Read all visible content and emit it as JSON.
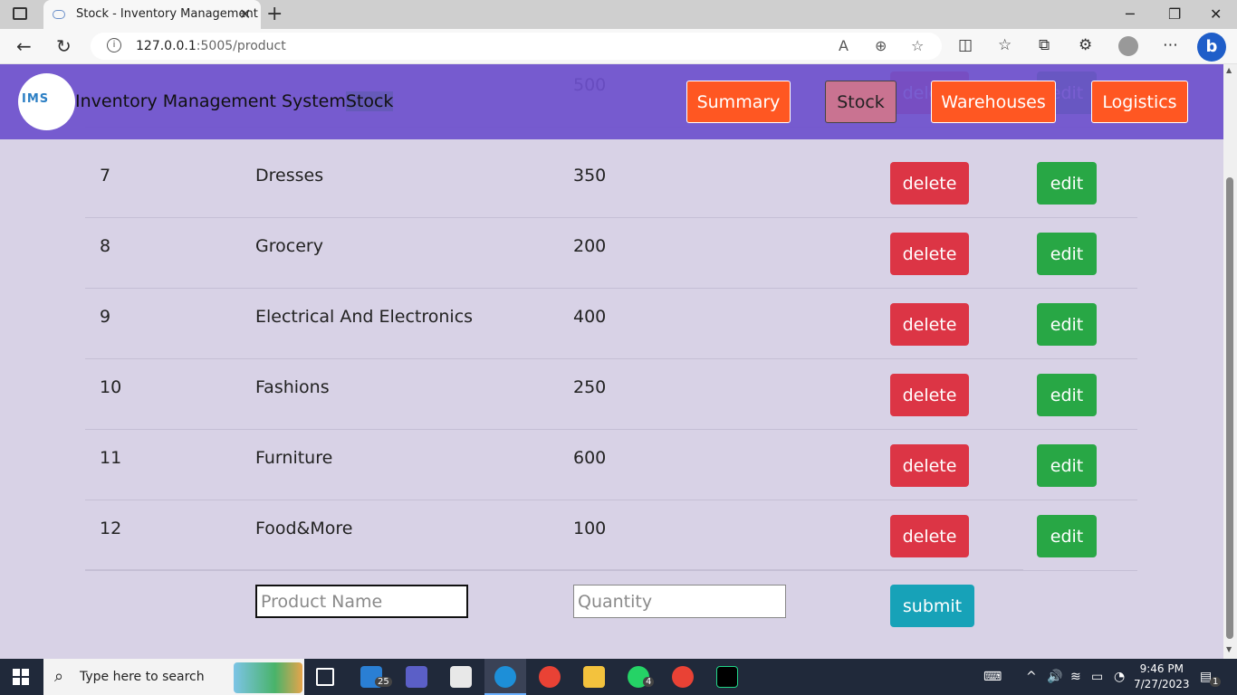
{
  "browser": {
    "tab_title": "Stock - Inventory Management",
    "url_host": "127.0.0.1",
    "url_path": ":5005/product"
  },
  "header": {
    "logo_text": "IMS",
    "brand_text": "Inventory Management System",
    "brand_suffix": "Stock",
    "nav": {
      "summary": "Summary",
      "stock": "Stock",
      "warehouses": "Warehouses",
      "logistics": "Logistics"
    }
  },
  "partial_row": {
    "quantity": "500"
  },
  "table": {
    "delete_label": "delete",
    "edit_label": "edit",
    "rows": [
      {
        "id": "7",
        "name": "Dresses",
        "quantity": "350"
      },
      {
        "id": "8",
        "name": "Grocery",
        "quantity": "200"
      },
      {
        "id": "9",
        "name": "Electrical And Electronics",
        "quantity": "400"
      },
      {
        "id": "10",
        "name": "Fashions",
        "quantity": "250"
      },
      {
        "id": "11",
        "name": "Furniture",
        "quantity": "600"
      },
      {
        "id": "12",
        "name": "Food&More",
        "quantity": "100"
      }
    ]
  },
  "form": {
    "name_placeholder": "Product Name",
    "qty_placeholder": "Quantity",
    "submit_label": "submit"
  },
  "taskbar": {
    "search_placeholder": "Type here to search",
    "mail_badge": "25",
    "whatsapp_badge": "4",
    "time": "9:46 PM",
    "date": "7/27/2023",
    "notification_count": "1"
  },
  "colors": {
    "header_bg": "#6e50cd",
    "page_bg": "#d8d2e6",
    "nav_orange": "#ff5722",
    "nav_active": "#c97391",
    "delete": "#dc3545",
    "edit": "#28a745",
    "submit": "#17a2b8"
  }
}
